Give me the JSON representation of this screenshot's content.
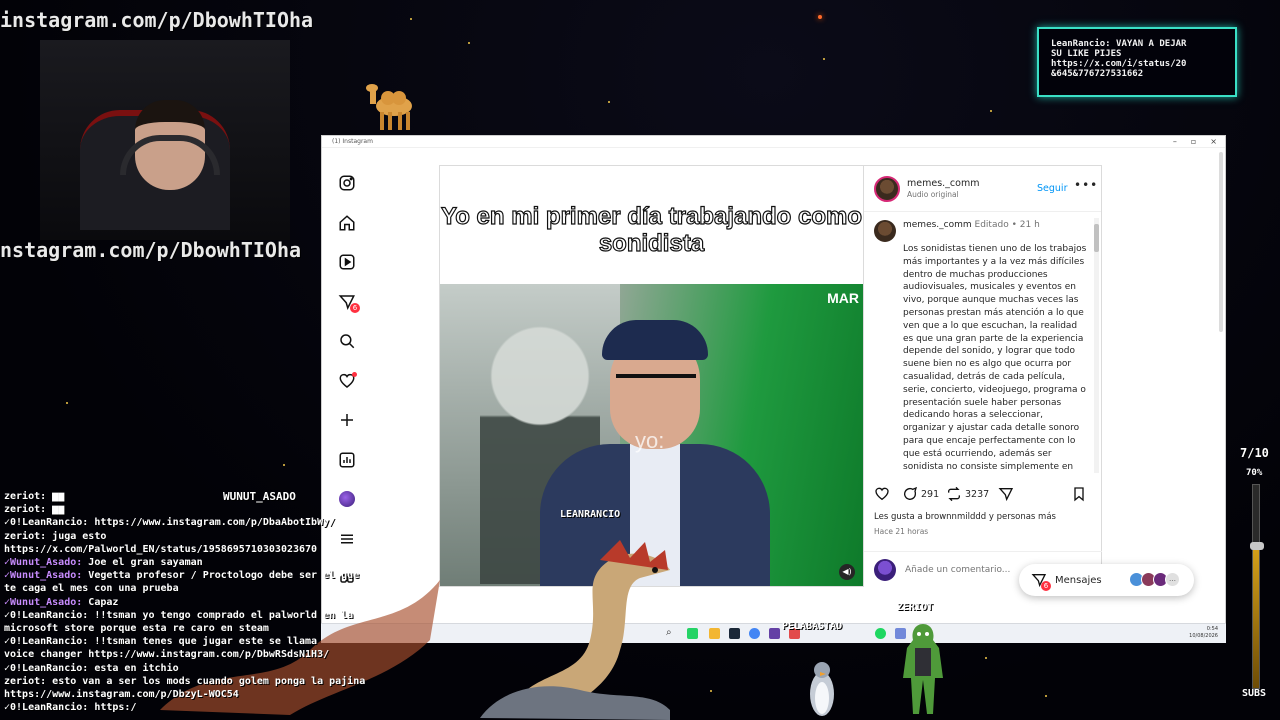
{
  "overlay": {
    "url_banner_top": "instagram.com/p/DbowhTIOha",
    "url_banner_mid": "nstagram.com/p/DbowhTIOha",
    "notification_lines": [
      "LeanRancio: VAYAN A DEJAR",
      "SU LIKE PIJES",
      "https://x.com/i/status/20",
      "&645&776727531662"
    ],
    "name_wunut": "WUNUT_ASADO",
    "name_leanrancio": "LEANRANCIO",
    "name_pelabastad": "PELABASTAD",
    "name_zeriot": "ZERIOT",
    "counter": "7/10",
    "percent": "70%",
    "percent_value": 0.7,
    "subs_label": "SUBS"
  },
  "browser": {
    "tab_title": "(1) Instagram"
  },
  "sidebar": {
    "items": [
      {
        "name": "instagram-logo-icon"
      },
      {
        "name": "home-icon"
      },
      {
        "name": "reels-icon"
      },
      {
        "name": "messages-icon",
        "badge": "6"
      },
      {
        "name": "search-icon"
      },
      {
        "name": "notifications-heart-icon"
      },
      {
        "name": "create-icon"
      },
      {
        "name": "dashboard-icon"
      },
      {
        "name": "profile-avatar"
      },
      {
        "name": "menu-icon"
      },
      {
        "name": "apps-icon"
      }
    ]
  },
  "video": {
    "caption": "Yo en mi primer día trabajando como sonidista",
    "logo_text": "MAR",
    "overlay_text": "yo:"
  },
  "post": {
    "username": "memes._comm",
    "audio": "Audio original",
    "follow": "Seguir",
    "more": "•••",
    "comment_username": "memes._comm",
    "comment_edited": "Editado",
    "comment_time": "21 h",
    "caption": "Los sonidistas tienen uno de los trabajos más importantes y a la vez más difíciles dentro de muchas producciones audiovisuales, musicales y eventos en vivo, porque aunque muchas veces las personas prestan más atención a lo que ven que a lo que escuchan, la realidad es que una gran parte de la experiencia depende del sonido, y lograr que todo suene bien no es algo que ocurra por casualidad, detrás de cada película, serie, concierto, videojuego, programa o presentación suele haber personas dedicando horas a seleccionar, organizar y ajustar cada detalle sonoro para que encaje perfectamente con lo que está ocurriendo, además ser sonidista no consiste simplemente en poner sonidos al azar, porque cada efecto, cada",
    "comments_count": "291",
    "reposts_count": "3237",
    "likes_prefix": "Les gusta a",
    "likes_user": "brownnmilddd",
    "likes_join": "y",
    "likes_more": "personas más",
    "time_ago": "Hace 21 horas",
    "comment_placeholder": "Añade un comentario..."
  },
  "messages": {
    "label": "Mensajes",
    "badge": "6"
  },
  "taskbar": {
    "time": "0:54",
    "date": "10/08/2026"
  },
  "chat": [
    {
      "user": "zeriot:",
      "text": " ▆▆"
    },
    {
      "user": "zeriot:",
      "text": " ▆▆"
    },
    {
      "user": "✓0!LeanRancio:",
      "text": " https://www.instagram.com/p/DbaAbotIbWy/"
    },
    {
      "user": "zeriot:",
      "text": " juga esto"
    },
    {
      "user": "",
      "text": "https://x.com/Palworld_EN/status/1958695710303023670"
    },
    {
      "user": "✓Wunut_Asado:",
      "text": " Joe el gran sayaman"
    },
    {
      "user": "✓Wunut_Asado:",
      "text": " Vegetta profesor / Proctologo debe ser el que"
    },
    {
      "user": "",
      "text": "te caga el mes con una prueba"
    },
    {
      "user": "✓Wunut_Asado:",
      "text": " Capaz"
    },
    {
      "user": "✓0!LeanRancio:",
      "text": " !!tsman yo tengo comprado el palworld en la"
    },
    {
      "user": "",
      "text": "microsoft store porque esta re caro en steam"
    },
    {
      "user": "✓0!LeanRancio:",
      "text": " !!tsman tenes que jugar este se llama"
    },
    {
      "user": "",
      "text": "voice changer https://www.instagram.com/p/DbwRSdsN1H3/"
    },
    {
      "user": "✓0!LeanRancio:",
      "text": " esta en itchio"
    },
    {
      "user": "zeriot:",
      "text": " esto van a ser los mods cuando golem ponga la pajina"
    },
    {
      "user": "",
      "text": "https://www.instagram.com/p/DbzyL-WOC54"
    },
    {
      "user": "✓0!LeanRancio:",
      "text": " https:/"
    }
  ],
  "colors": {
    "accent_blue": "#0095f6",
    "notif_border": "#3ae0c6",
    "badge_red": "#ff3040"
  }
}
